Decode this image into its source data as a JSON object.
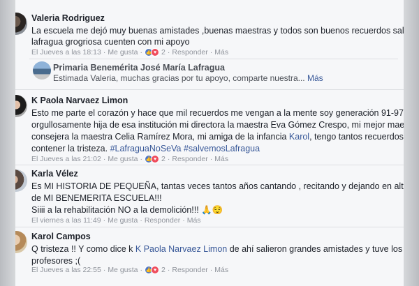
{
  "comments": [
    {
      "name": "Valeria Rodriguez",
      "text_lines": [
        "La escuela me dejó muy buenas amistades ,buenas maestras y todos son buenos recuerdos salve escuela",
        "lafragua grogriosa cuenten con mi apoyo"
      ],
      "time": "El Jueves a las 18:13",
      "like": "Me gusta",
      "reactions": "2",
      "reply": "Responder",
      "more": "Más",
      "reply_comment": {
        "name": "Primaria Benemérita José María Lafragua",
        "text": "Estimada Valeria, muchas gracias por tu apoyo, comparte nuestra...",
        "more": "Más"
      }
    },
    {
      "name": "K Paola Narvaez Limon",
      "text_lines": [
        "Esto me parte el corazón y hace que mil recuerdos me vengan a la mente soy generación 91-97",
        "orgullosamente hija de esa institución mi directora la maestra Eva Gómez Crespo, mi mejor maestra amiga y",
        "consejera la maestra Celia Ramírez Mora, mi amiga de la infancia ",
        "contener la tristeza. "
      ],
      "mention": "Karol",
      "line3_tail": ", tengo tantos recuerdos k no puedo",
      "hashtags": "#LafraguaNoSeVa #salvemosLafragua",
      "time": "El Jueves a las 21:02",
      "like": "Me gusta",
      "reactions": "2",
      "reply": "Responder",
      "more": "Más"
    },
    {
      "name": "Karla Vélez",
      "text_lines": [
        "Es MI HISTORIA DE PEQUEÑA, tantas veces tantos años cantando , recitando y dejando en alto el nombre",
        "de MI BENEMERITA ESCUELA!!!",
        "Siiii a la rehabilitación NO a la demolición!!! "
      ],
      "emoji": "🙏😌",
      "time": "El viernes a las 11:49",
      "like": "Me gusta",
      "reply": "Responder",
      "more": "Más"
    },
    {
      "name": "Karol Campos",
      "text_lines": [
        "Q tristeza !! Y como dice k ",
        "profesores ;("
      ],
      "mention": "K Paola Narvaez Limon",
      "line1_tail": " de ahí salieron grandes amistades y tuve los mejores",
      "time": "El Jueves a las 22:55",
      "like": "Me gusta",
      "reactions": "2",
      "reply": "Responder",
      "more": "Más"
    }
  ],
  "colors": {
    "name": "#1d2129",
    "link": "#385898",
    "meta": "#90949c",
    "like_reaction": "#4c76c9",
    "love_reaction": "#ef4d5d"
  }
}
